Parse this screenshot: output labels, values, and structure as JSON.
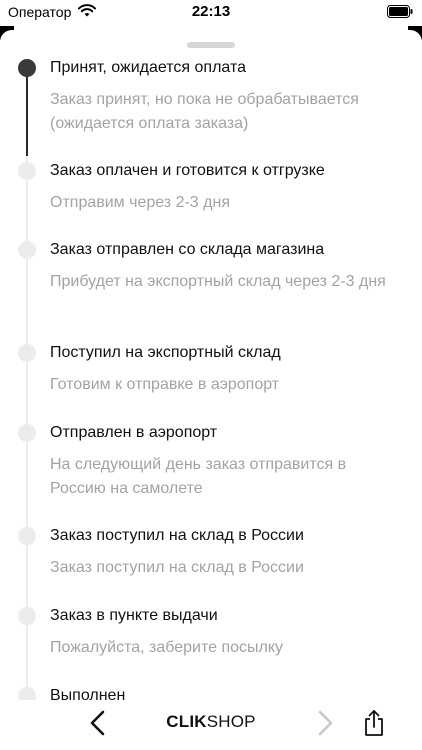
{
  "status_bar": {
    "carrier": "Оператор",
    "time": "22:13"
  },
  "steps": [
    {
      "title": "Принят, ожидается оплата",
      "desc": "Заказ принят, но пока не обрабатывается (ожидается оплата заказа)",
      "active": true
    },
    {
      "title": "Заказ оплачен и готовится к отгрузке",
      "desc": "Отправим через 2-3 дня",
      "active": false
    },
    {
      "title": "Заказ отправлен со склада магазина",
      "desc": "Прибудет на экспортный склад через 2-3 дня",
      "active": false
    },
    {
      "title": "Поступил на экспортный склад",
      "desc": "Готовим к отправке в аэропорт",
      "active": false
    },
    {
      "title": "Отправлен в аэропорт",
      "desc": "На следующий день заказ отправится в Россию на самолете",
      "active": false
    },
    {
      "title": "Заказ поступил на склад в России",
      "desc": "Заказ поступил на склад в России",
      "active": false
    },
    {
      "title": "Заказ в пункте выдачи",
      "desc": "Пожалуйста, заберите посылку",
      "active": false
    },
    {
      "title": "Выполнен",
      "desc": "",
      "active": false
    }
  ],
  "bottom_bar": {
    "brand_bold": "CLIK",
    "brand_regular": "SHOP"
  },
  "icons": {
    "back": "chevron-left-icon",
    "forward": "chevron-right-icon",
    "share": "share-icon",
    "wifi": "wifi-icon",
    "battery": "battery-icon"
  },
  "colors": {
    "active_dot": "#3a3a3a",
    "inactive_dot": "#ececec",
    "description_text": "#a3a3a3",
    "forward_disabled": "#c8c8c8"
  }
}
